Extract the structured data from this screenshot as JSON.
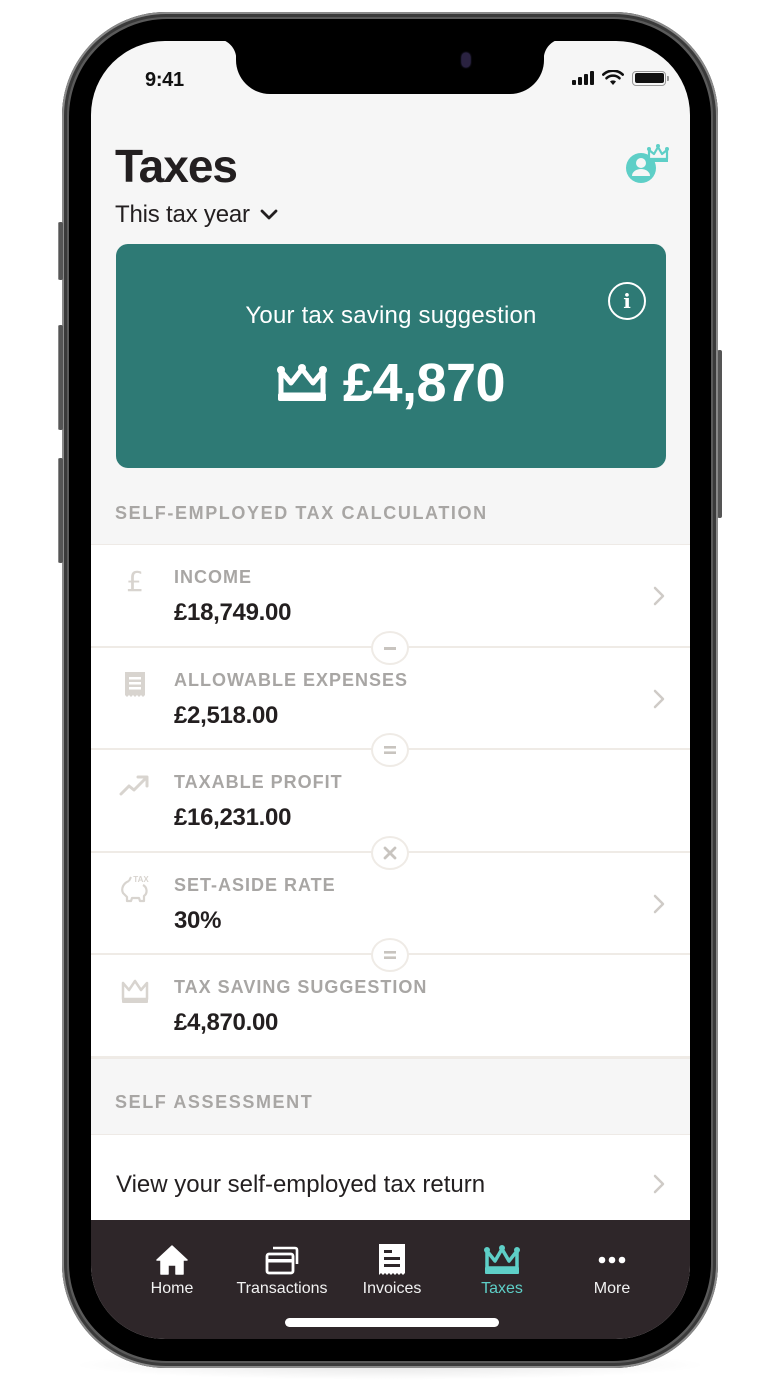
{
  "status_bar": {
    "time": "9:41"
  },
  "header": {
    "title": "Taxes",
    "period_selector": "This tax year"
  },
  "banner": {
    "title": "Your tax saving suggestion",
    "amount": "£4,870",
    "info_icon": "i"
  },
  "calculation": {
    "section_title": "SELF-EMPLOYED TAX CALCULATION",
    "rows": [
      {
        "label": "INCOME",
        "value": "£18,749.00",
        "icon": "pound-icon",
        "has_chevron": true
      },
      {
        "label": "ALLOWABLE EXPENSES",
        "value": "£2,518.00",
        "icon": "receipt-icon",
        "has_chevron": true
      },
      {
        "label": "TAXABLE PROFIT",
        "value": "£16,231.00",
        "icon": "trend-up-icon",
        "has_chevron": false
      },
      {
        "label": "SET-ASIDE RATE",
        "value": "30%",
        "icon": "piggy-bank-tax-icon",
        "has_chevron": true
      },
      {
        "label": "TAX SAVING SUGGESTION",
        "value": "£4,870.00",
        "icon": "crown-icon",
        "has_chevron": false
      }
    ],
    "operators": [
      "minus",
      "equals",
      "multiply",
      "equals"
    ]
  },
  "self_assessment": {
    "section_title": "SELF ASSESSMENT",
    "link_label": "View your self-employed tax return"
  },
  "tabbar": {
    "tabs": [
      {
        "label": "Home",
        "icon": "home-icon",
        "active": false
      },
      {
        "label": "Transactions",
        "icon": "cards-icon",
        "active": false
      },
      {
        "label": "Invoices",
        "icon": "invoice-icon",
        "active": false
      },
      {
        "label": "Taxes",
        "icon": "crown-icon",
        "active": true
      },
      {
        "label": "More",
        "icon": "more-dots-icon",
        "active": false
      }
    ]
  },
  "colors": {
    "banner": "#2e7a75",
    "accent": "#5ecfc7",
    "text_primary": "#231f20",
    "text_muted": "#a8a6a4",
    "tabbar_bg": "#2e2629"
  }
}
